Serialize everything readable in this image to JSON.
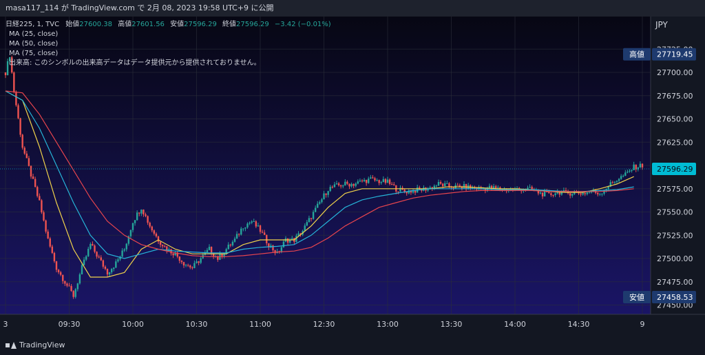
{
  "header": {
    "title": "masa117_114 が TradingView.com で 2月 08, 2023 19:58 UTC+9 に公開"
  },
  "legend": {
    "symbol": "日経225, 1, TVC",
    "open_label": "始値",
    "open_value": "27600.38",
    "high_label": "高値",
    "high_value": "27601.56",
    "low_label": "安値",
    "low_value": "27596.29",
    "close_label": "終値",
    "close_value": "27596.29",
    "change": "−3.42 (−0.01%)",
    "ma25": "MA (25, close)",
    "ma50": "MA (50, close)",
    "ma75": "MA (75, close)",
    "volume_note": "出来高: このシンボルの出来高データはデータ提供元から提供されておりません。"
  },
  "currency": "JPY",
  "footer": {
    "brand": "TradingView"
  },
  "colors": {
    "up": "#26a69a",
    "down": "#ef5350",
    "ma25": "#f0d24b",
    "ma50": "#26b5d9",
    "ma75": "#e8454d",
    "bg_top": "#070713",
    "bg_bottom": "#1a1566"
  },
  "chart_data": {
    "type": "candlestick",
    "y_axis": {
      "ylim": [
        27440,
        27760
      ],
      "ticks": [
        "27725.00",
        "27700.00",
        "27675.00",
        "27650.00",
        "27625.00",
        "27600.00",
        "27575.00",
        "27550.00",
        "27525.00",
        "27500.00",
        "27475.00",
        "27450.00"
      ]
    },
    "x_axis": {
      "ticks": [
        {
          "label": "3",
          "t": 0
        },
        {
          "label": "09:30",
          "t": 30
        },
        {
          "label": "10:00",
          "t": 60
        },
        {
          "label": "10:30",
          "t": 90
        },
        {
          "label": "11:00",
          "t": 120
        },
        {
          "label": "12:30",
          "t": 150
        },
        {
          "label": "13:00",
          "t": 180
        },
        {
          "label": "13:30",
          "t": 210
        },
        {
          "label": "14:00",
          "t": 240
        },
        {
          "label": "14:30",
          "t": 270
        },
        {
          "label": "9",
          "t": 300
        }
      ]
    },
    "price_badges": [
      {
        "label": "高値",
        "value": "27719.45",
        "price": 27719.45,
        "color": "#1e3a6e"
      },
      {
        "label": "",
        "value": "27596.29",
        "price": 27596.29,
        "color": "#00bcd4"
      },
      {
        "label": "安値",
        "value": "27458.53",
        "price": 27458.53,
        "color": "#1e3a6e"
      }
    ],
    "series": [
      {
        "name": "日経225",
        "kind": "candles",
        "close_path": [
          [
            0,
            27700
          ],
          [
            2,
            27719
          ],
          [
            4,
            27680
          ],
          [
            8,
            27620
          ],
          [
            12,
            27590
          ],
          [
            16,
            27560
          ],
          [
            20,
            27520
          ],
          [
            24,
            27490
          ],
          [
            28,
            27475
          ],
          [
            32,
            27460
          ],
          [
            36,
            27490
          ],
          [
            40,
            27515
          ],
          [
            44,
            27500
          ],
          [
            48,
            27485
          ],
          [
            52,
            27495
          ],
          [
            56,
            27510
          ],
          [
            60,
            27540
          ],
          [
            64,
            27555
          ],
          [
            68,
            27535
          ],
          [
            72,
            27520
          ],
          [
            76,
            27510
          ],
          [
            80,
            27505
          ],
          [
            84,
            27495
          ],
          [
            88,
            27490
          ],
          [
            92,
            27500
          ],
          [
            96,
            27510
          ],
          [
            100,
            27500
          ],
          [
            104,
            27510
          ],
          [
            108,
            27520
          ],
          [
            112,
            27535
          ],
          [
            116,
            27540
          ],
          [
            120,
            27530
          ],
          [
            124,
            27515
          ],
          [
            128,
            27505
          ],
          [
            132,
            27520
          ],
          [
            136,
            27520
          ],
          [
            140,
            27530
          ],
          [
            144,
            27545
          ],
          [
            148,
            27560
          ],
          [
            152,
            27575
          ],
          [
            156,
            27578
          ],
          [
            160,
            27580
          ],
          [
            164,
            27580
          ],
          [
            168,
            27583
          ],
          [
            172,
            27585
          ],
          [
            176,
            27583
          ],
          [
            180,
            27582
          ],
          [
            184,
            27575
          ],
          [
            188,
            27572
          ],
          [
            192,
            27573
          ],
          [
            196,
            27574
          ],
          [
            200,
            27576
          ],
          [
            204,
            27580
          ],
          [
            208,
            27578
          ],
          [
            212,
            27577
          ],
          [
            216,
            27577
          ],
          [
            220,
            27576
          ],
          [
            224,
            27575
          ],
          [
            228,
            27576
          ],
          [
            232,
            27575
          ],
          [
            236,
            27574
          ],
          [
            240,
            27574
          ],
          [
            244,
            27575
          ],
          [
            248,
            27574
          ],
          [
            252,
            27570
          ],
          [
            256,
            27568
          ],
          [
            260,
            27572
          ],
          [
            264,
            27570
          ],
          [
            268,
            27571
          ],
          [
            272,
            27570
          ],
          [
            276,
            27572
          ],
          [
            280,
            27570
          ],
          [
            284,
            27578
          ],
          [
            288,
            27585
          ],
          [
            292,
            27590
          ],
          [
            296,
            27598
          ],
          [
            300,
            27600
          ]
        ]
      },
      {
        "name": "MA (25, close)",
        "kind": "line",
        "color_key": "ma25",
        "points": [
          [
            0,
            27680
          ],
          [
            8,
            27670
          ],
          [
            16,
            27620
          ],
          [
            24,
            27560
          ],
          [
            32,
            27510
          ],
          [
            40,
            27480
          ],
          [
            48,
            27480
          ],
          [
            56,
            27485
          ],
          [
            64,
            27510
          ],
          [
            72,
            27520
          ],
          [
            80,
            27510
          ],
          [
            88,
            27505
          ],
          [
            96,
            27505
          ],
          [
            104,
            27505
          ],
          [
            112,
            27515
          ],
          [
            120,
            27520
          ],
          [
            128,
            27520
          ],
          [
            136,
            27520
          ],
          [
            144,
            27535
          ],
          [
            152,
            27555
          ],
          [
            160,
            27570
          ],
          [
            168,
            27575
          ],
          [
            176,
            27575
          ],
          [
            184,
            27575
          ],
          [
            192,
            27575
          ],
          [
            200,
            27575
          ],
          [
            208,
            27577
          ],
          [
            216,
            27577
          ],
          [
            224,
            27576
          ],
          [
            232,
            27575
          ],
          [
            240,
            27575
          ],
          [
            248,
            27574
          ],
          [
            256,
            27572
          ],
          [
            264,
            27571
          ],
          [
            272,
            27571
          ],
          [
            280,
            27575
          ],
          [
            288,
            27580
          ],
          [
            296,
            27588
          ]
        ]
      },
      {
        "name": "MA (50, close)",
        "kind": "line",
        "color_key": "ma50",
        "points": [
          [
            0,
            27680
          ],
          [
            8,
            27670
          ],
          [
            16,
            27640
          ],
          [
            24,
            27600
          ],
          [
            32,
            27560
          ],
          [
            40,
            27525
          ],
          [
            48,
            27505
          ],
          [
            56,
            27500
          ],
          [
            64,
            27505
          ],
          [
            72,
            27510
          ],
          [
            80,
            27508
          ],
          [
            88,
            27507
          ],
          [
            96,
            27506
          ],
          [
            104,
            27506
          ],
          [
            112,
            27510
          ],
          [
            120,
            27512
          ],
          [
            128,
            27513
          ],
          [
            136,
            27515
          ],
          [
            144,
            27525
          ],
          [
            152,
            27540
          ],
          [
            160,
            27555
          ],
          [
            168,
            27563
          ],
          [
            176,
            27567
          ],
          [
            184,
            27570
          ],
          [
            192,
            27573
          ],
          [
            200,
            27575
          ],
          [
            208,
            27575
          ],
          [
            216,
            27575
          ],
          [
            224,
            27575
          ],
          [
            232,
            27574
          ],
          [
            240,
            27574
          ],
          [
            248,
            27574
          ],
          [
            256,
            27573
          ],
          [
            264,
            27572
          ],
          [
            272,
            27572
          ],
          [
            280,
            27573
          ],
          [
            288,
            27574
          ],
          [
            296,
            27577
          ]
        ]
      },
      {
        "name": "MA (75, close)",
        "kind": "line",
        "color_key": "ma75",
        "points": [
          [
            0,
            27680
          ],
          [
            8,
            27678
          ],
          [
            16,
            27655
          ],
          [
            24,
            27625
          ],
          [
            32,
            27595
          ],
          [
            40,
            27565
          ],
          [
            48,
            27540
          ],
          [
            56,
            27525
          ],
          [
            64,
            27515
          ],
          [
            72,
            27510
          ],
          [
            80,
            27506
          ],
          [
            88,
            27503
          ],
          [
            96,
            27502
          ],
          [
            104,
            27502
          ],
          [
            112,
            27503
          ],
          [
            120,
            27505
          ],
          [
            128,
            27507
          ],
          [
            136,
            27508
          ],
          [
            144,
            27512
          ],
          [
            152,
            27522
          ],
          [
            160,
            27535
          ],
          [
            168,
            27545
          ],
          [
            176,
            27555
          ],
          [
            184,
            27560
          ],
          [
            192,
            27565
          ],
          [
            200,
            27568
          ],
          [
            208,
            27570
          ],
          [
            216,
            27572
          ],
          [
            224,
            27573
          ],
          [
            232,
            27573
          ],
          [
            240,
            27573
          ],
          [
            248,
            27573
          ],
          [
            256,
            27572
          ],
          [
            264,
            27572
          ],
          [
            272,
            27572
          ],
          [
            280,
            27572
          ],
          [
            288,
            27573
          ],
          [
            296,
            27575
          ]
        ]
      }
    ]
  }
}
